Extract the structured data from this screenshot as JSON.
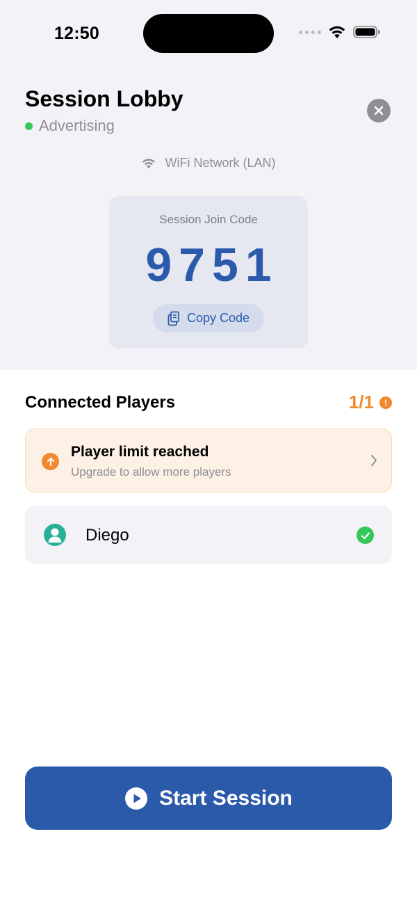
{
  "status_bar": {
    "time": "12:50",
    "icons": [
      "cellular-signal-icon",
      "wifi-icon",
      "battery-icon"
    ]
  },
  "header": {
    "title": "Session Lobby",
    "status": "Advertising",
    "status_color": "#34c759",
    "close_icon": "close-icon"
  },
  "network": {
    "label": "WiFi Network (LAN)",
    "icon": "wifi-icon"
  },
  "join_code": {
    "label": "Session Join Code",
    "code": "9751",
    "copy_label": "Copy Code",
    "copy_icon": "copy-icon",
    "accent": "#2c5aab"
  },
  "players": {
    "title": "Connected Players",
    "count": "1/1",
    "count_color": "#f0892f",
    "limit_banner": {
      "title": "Player limit reached",
      "subtitle": "Upgrade to allow more players",
      "icon": "upgrade-arrow-icon"
    },
    "list": [
      {
        "name": "Diego",
        "status": "connected",
        "avatar_icon": "person-icon",
        "status_icon": "checkmark-icon"
      }
    ]
  },
  "start_button": {
    "label": "Start Session",
    "icon": "play-icon",
    "color": "#2c5aab"
  }
}
